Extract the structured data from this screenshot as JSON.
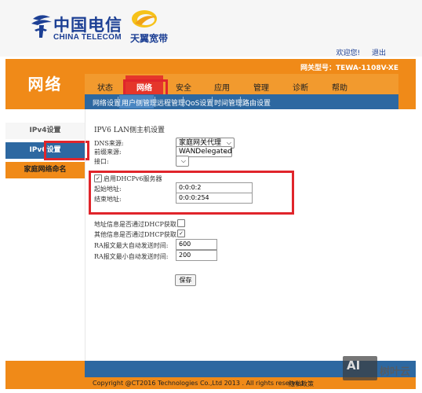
{
  "header": {
    "brand_cn": "中国电信",
    "brand_en": "CHINA TELECOM",
    "tianyi": "天翼宽带",
    "welcome": "欢迎您!",
    "logout": "退出",
    "model": "网关型号：TEWA-1108V-XE"
  },
  "section_title": "网络",
  "nav": [
    "状态",
    "网络",
    "安全",
    "应用",
    "管理",
    "诊断",
    "帮助"
  ],
  "subnav": [
    "网络设置",
    "用户侧管理",
    "远程管理",
    "QoS设置",
    "时间管理",
    "路由设置"
  ],
  "sidebar": {
    "ipv4": "IPv4设置",
    "ipv6": "IPv6设置",
    "family": "家庭网络命名"
  },
  "content": {
    "title": "IPV6 LAN侧主机设置",
    "dns_label": "DNS来源:",
    "dns_value": "家庭网关代理",
    "prefix_label": "前缀来源:",
    "prefix_value": "WANDelegated",
    "interface_label": "接口:",
    "interface_value": "",
    "dhcp_enable_label": "启用DHCPv6服务器",
    "start_label": "起始地址:",
    "start_value": "0:0:0:2",
    "end_label": "结束地址:",
    "end_value": "0:0:0:254",
    "addr_dhcp_label": "地址信息是否通过DHCP获取:",
    "other_dhcp_label": "其他信息是否通过DHCP获取:",
    "ra_max_label": "RA报文最大自动发送时间:",
    "ra_max_value": "600",
    "ra_min_label": "RA报文最小自动发送时间:",
    "ra_min_value": "200",
    "save": "保存",
    "checks": {
      "dhcp_enabled": true,
      "addr_dhcp": false,
      "other_dhcp": true
    },
    "check_mark": "✓"
  },
  "footer": {
    "copyright": "Copyright @CT2016 Technologies Co.,Ltd 2013 . All rights reserved.",
    "privacy": "隐私政策"
  },
  "watermark": {
    "ai": "AI",
    "text": "树叶云"
  },
  "colors": {
    "orange": "#f08a18",
    "blue": "#2d68a1",
    "red": "#e0252b",
    "brand": "#1c3f94"
  }
}
